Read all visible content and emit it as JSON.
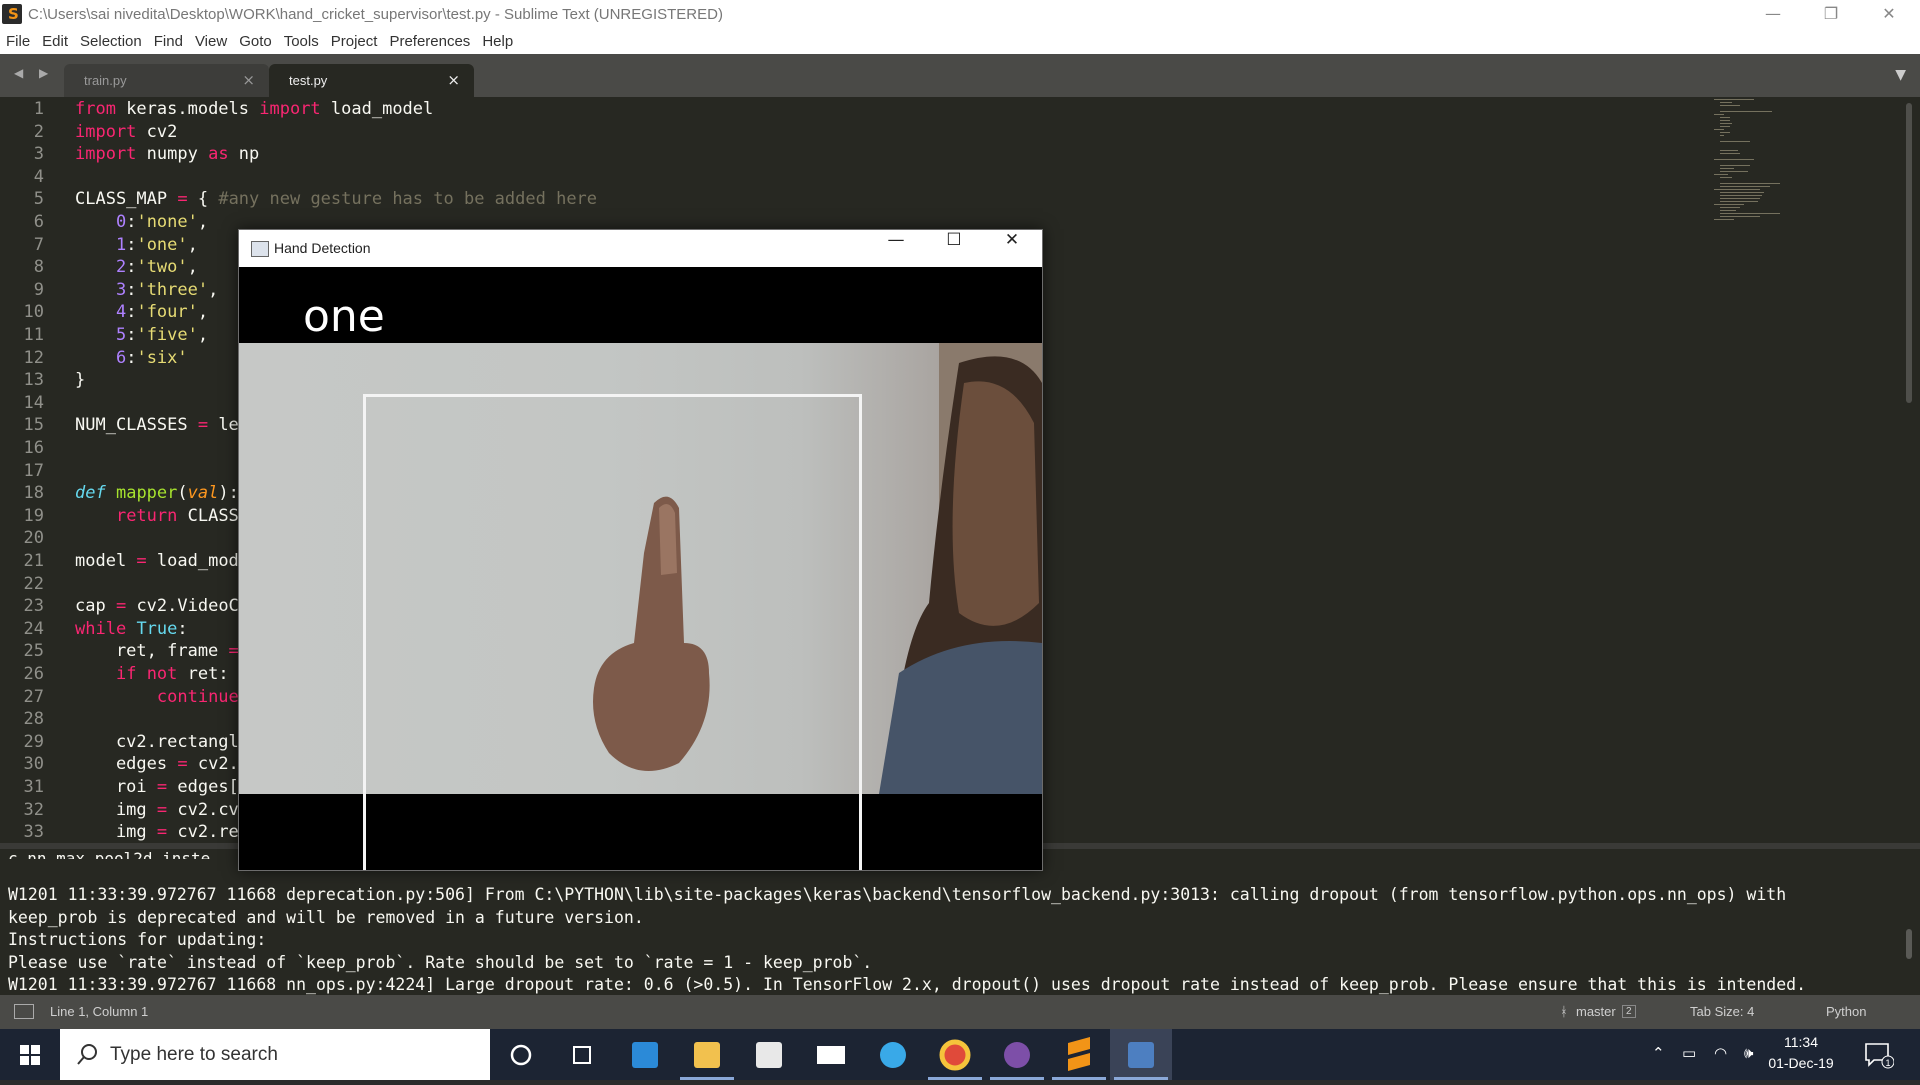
{
  "window": {
    "title": "C:\\Users\\sai nivedita\\Desktop\\WORK\\hand_cricket_supervisor\\test.py - Sublime Text (UNREGISTERED)",
    "app_icon": "S",
    "controls": {
      "minimize": "—",
      "restore": "❐",
      "close": "✕"
    }
  },
  "menu": [
    "File",
    "Edit",
    "Selection",
    "Find",
    "View",
    "Goto",
    "Tools",
    "Project",
    "Preferences",
    "Help"
  ],
  "tabs": [
    {
      "label": "train.py",
      "active": false,
      "close": "×"
    },
    {
      "label": "test.py",
      "active": true,
      "close": "×"
    }
  ],
  "tab_nav": {
    "arrows": "◀ ▶",
    "dropdown": "▼"
  },
  "editor": {
    "line_numbers": [
      "1",
      "2",
      "3",
      "4",
      "5",
      "6",
      "7",
      "8",
      "9",
      "10",
      "11",
      "12",
      "13",
      "14",
      "15",
      "16",
      "17",
      "18",
      "19",
      "20",
      "21",
      "22",
      "23",
      "24",
      "25",
      "26",
      "27",
      "28",
      "29",
      "30",
      "31",
      "32",
      "33"
    ],
    "lines": [
      "from keras.models import load_model",
      "import cv2",
      "import numpy as np",
      "",
      "CLASS_MAP = { #any new gesture has to be added here",
      "    0:'none',",
      "    1:'one',",
      "    2:'two',",
      "    3:'three',",
      "    4:'four',",
      "    5:'five',",
      "    6:'six'",
      "}",
      "",
      "NUM_CLASSES = le",
      "",
      "",
      "def mapper(val):",
      "    return CLASS",
      "",
      "model = load_mod",
      "",
      "cap = cv2.VideoC",
      "while True:",
      "    ret, frame =",
      "    if not ret:",
      "        continue",
      "",
      "    cv2.rectangl",
      "    edges = cv2.",
      "    roi = edges[",
      "    img = cv2.cv",
      "    img = cv2.re"
    ]
  },
  "console": {
    "cutoff_line": "c.nn.max_pool2d inste",
    "lines": [
      "W1201 11:33:39.972767 11668 deprecation.py:506] From C:\\PYTHON\\lib\\site-packages\\keras\\backend\\tensorflow_backend.py:3013: calling dropout (from tensorflow.python.ops.nn_ops) with",
      "keep_prob is deprecated and will be removed in a future version.",
      "Instructions for updating:",
      "Please use `rate` instead of `keep_prob`. Rate should be set to `rate = 1 - keep_prob`.",
      "W1201 11:33:39.972767 11668 nn_ops.py:4224] Large dropout rate: 0.6 (>0.5). In TensorFlow 2.x, dropout() uses dropout rate instead of keep_prob. Please ensure that this is intended."
    ]
  },
  "status": {
    "position": "Line 1, Column 1",
    "branch": "master",
    "branch_count": "2",
    "tab_size": "Tab Size: 4",
    "syntax": "Python"
  },
  "overlay_window": {
    "title": "Hand Detection",
    "prediction": "one",
    "controls": {
      "minimize": "—",
      "maximize": "☐",
      "close": "✕"
    }
  },
  "taskbar": {
    "search_placeholder": "Type here to search",
    "apps": [
      "cortana-icon",
      "task-view-icon",
      "edge-icon",
      "file-explorer-icon",
      "store-icon",
      "mail-icon",
      "sync-icon",
      "chrome-icon",
      "github-icon",
      "sublime-icon",
      "python-icon"
    ],
    "time": "11:34",
    "date": "01-Dec-19",
    "notification_count": "1"
  },
  "colors": {
    "editor_bg": "#272822",
    "keyword": "#f92672",
    "string": "#e6db74",
    "number": "#ae81ff",
    "comment": "#75715e",
    "builtin": "#66d9ef",
    "taskbar": "#1c2433"
  }
}
